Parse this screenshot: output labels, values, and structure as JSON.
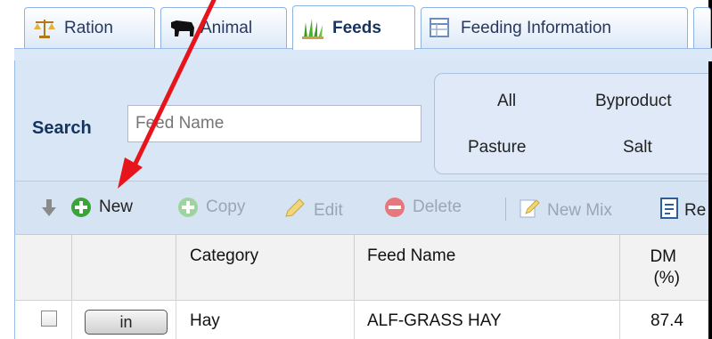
{
  "tabs": [
    {
      "label": "Ration",
      "icon": "scale-icon",
      "active": false
    },
    {
      "label": "Animal",
      "icon": "cow-icon",
      "active": false
    },
    {
      "label": "Feeds",
      "icon": "grass-icon",
      "active": true
    },
    {
      "label": "Feeding Information",
      "icon": "table-icon",
      "active": false
    }
  ],
  "search": {
    "label": "Search",
    "placeholder": "Feed Name"
  },
  "filters": [
    "All",
    "Byproduct",
    "Pasture",
    "Salt"
  ],
  "toolbar": {
    "new_label": "New",
    "copy_label": "Copy",
    "edit_label": "Edit",
    "delete_label": "Delete",
    "new_mix_label": "New Mix",
    "truncated_label": "Re"
  },
  "grid": {
    "columns": [
      "",
      "",
      "Category",
      "Feed Name",
      "DM",
      "(%)"
    ],
    "rows": [
      {
        "button": "in",
        "category": "Hay",
        "feed_name": "ALF-GRASS HAY",
        "dm": "87.4"
      }
    ]
  },
  "colors": {
    "annotation_arrow": "#e8141b",
    "panel": "#d9e6f5",
    "accent": "#15335f"
  }
}
